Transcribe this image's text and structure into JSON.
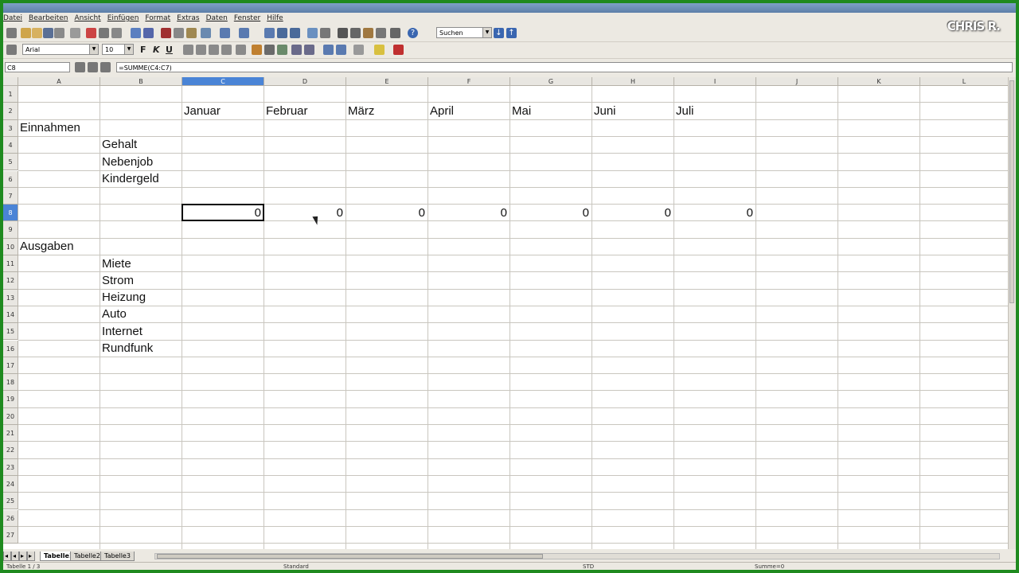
{
  "watermark": "CHRIS R.",
  "menu": [
    "Datei",
    "Bearbeiten",
    "Ansicht",
    "Einfügen",
    "Format",
    "Extras",
    "Daten",
    "Fenster",
    "Hilfe"
  ],
  "toolbar": {
    "search_placeholder": "Suchen",
    "font_name": "Arial",
    "font_size": "10",
    "bold_label": "F",
    "italic_label": "K",
    "underline_label": "U"
  },
  "formula_bar": {
    "name_box": "C8",
    "formula": "=SUMME(C4:C7)"
  },
  "columns": [
    "A",
    "B",
    "C",
    "D",
    "E",
    "F",
    "G",
    "H",
    "I",
    "J",
    "K",
    "L"
  ],
  "selected_column": "C",
  "rows": [
    "1",
    "2",
    "3",
    "4",
    "5",
    "6",
    "7",
    "8",
    "9",
    "10",
    "11",
    "12",
    "13",
    "14",
    "15",
    "16",
    "17",
    "18",
    "19",
    "20",
    "21",
    "22",
    "23",
    "24",
    "25",
    "26",
    "27"
  ],
  "selected_row": "8",
  "cells": {
    "C2": "Januar",
    "D2": "Februar",
    "E2": "März",
    "F2": "April",
    "G2": "Mai",
    "H2": "Juni",
    "I2": "Juli",
    "A3": "Einnahmen",
    "B4": "Gehalt",
    "B5": "Nebenjob",
    "B6": "Kindergeld",
    "C8": "0",
    "D8": "0",
    "E8": "0",
    "F8": "0",
    "G8": "0",
    "H8": "0",
    "I8": "0",
    "A10": "Ausgaben",
    "B11": "Miete",
    "B12": "Strom",
    "B13": "Heizung",
    "B14": "Auto",
    "B15": "Internet",
    "B16": "Rundfunk"
  },
  "sheet_tabs": [
    "Tabelle1",
    "Tabelle2",
    "Tabelle3"
  ],
  "active_sheet": "Tabelle1",
  "status": {
    "page": "Tabelle 1 / 3",
    "style": "Standard",
    "mode": "STD",
    "sum": "Summe=0"
  },
  "colors": {
    "frame": "#1f8a1f",
    "selected_header": "#4a84d6"
  }
}
